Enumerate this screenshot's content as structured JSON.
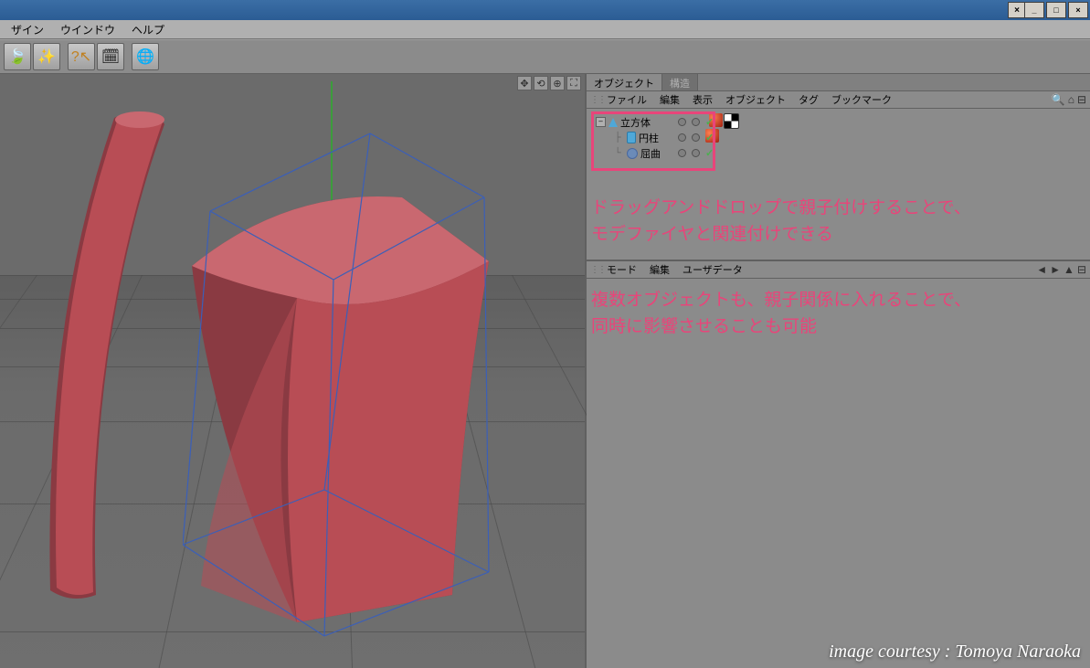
{
  "menubar": {
    "items": [
      "ザイン",
      "ウインドウ",
      "ヘルプ"
    ]
  },
  "toolbar": {
    "icons": [
      "leaf-icon",
      "particles-icon",
      "help-arrow-icon",
      "calendar-icon",
      "globe-icon"
    ]
  },
  "viewport": {
    "nav_icons": [
      "move-icon",
      "rotate-icon",
      "zoom-icon",
      "maximize-icon"
    ]
  },
  "object_panel": {
    "tabs": [
      {
        "label": "オブジェクト",
        "active": true
      },
      {
        "label": "構造",
        "active": false
      }
    ],
    "menu": [
      "ファイル",
      "編集",
      "表示",
      "オブジェクト",
      "タグ",
      "ブックマーク"
    ],
    "tree": [
      {
        "label": "立方体",
        "icon": "cone-icon",
        "depth": 0,
        "expandable": true
      },
      {
        "label": "円柱",
        "icon": "cylinder-icon",
        "depth": 1,
        "expandable": false
      },
      {
        "label": "屈曲",
        "icon": "bend-icon",
        "depth": 1,
        "expandable": false
      }
    ]
  },
  "attr_panel": {
    "menu": [
      "モード",
      "編集",
      "ユーザデータ"
    ]
  },
  "annotations": {
    "line1": "ドラッグアンドドロップで親子付けすることで、",
    "line2": "モデファイヤと関連付けできる",
    "line3": "複数オブジェクトも、親子関係に入れることで、",
    "line4": "同時に影響させることも可能"
  },
  "courtesy": "image courtesy : Tomoya Naraoka",
  "win_btns": {
    "min": "_",
    "max": "□",
    "close": "×",
    "x2": "×"
  }
}
